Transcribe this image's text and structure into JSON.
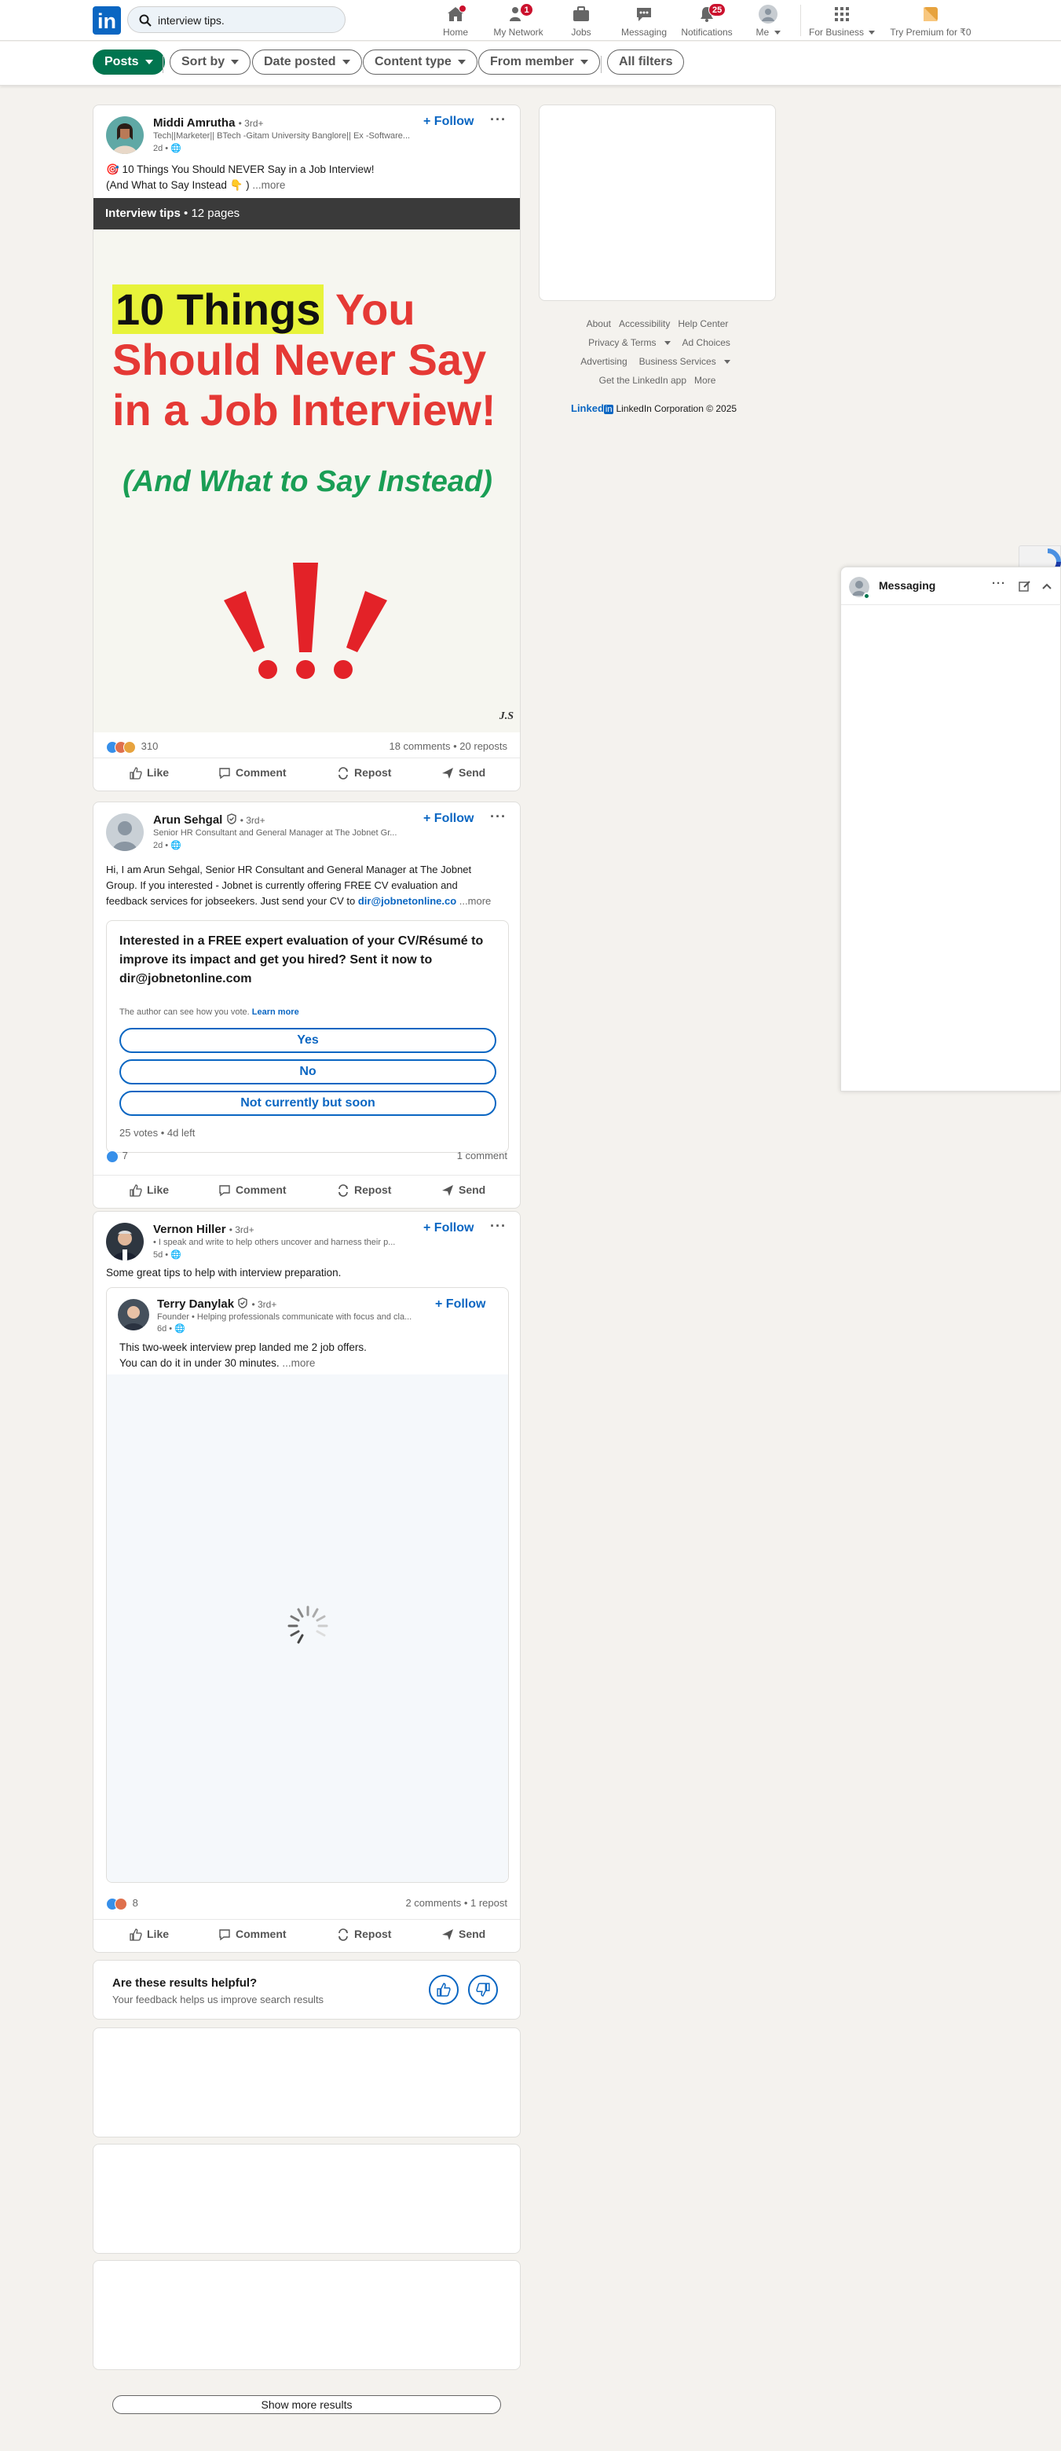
{
  "nav": {
    "search_value": "interview tips.",
    "items": [
      {
        "label": "Home",
        "icon": "home-icon",
        "badge": ""
      },
      {
        "label": "My Network",
        "icon": "network-icon",
        "badge": "1"
      },
      {
        "label": "Jobs",
        "icon": "jobs-icon",
        "badge": ""
      },
      {
        "label": "Messaging",
        "icon": "messaging-icon",
        "badge": ""
      },
      {
        "label": "Notifications",
        "icon": "bell-icon",
        "badge": "25"
      },
      {
        "label": "Me",
        "icon": "avatar",
        "badge": ""
      },
      {
        "label": "For Business",
        "icon": "grid-icon",
        "badge": ""
      },
      {
        "label": "Try Premium for ₹0",
        "icon": "premium-icon",
        "badge": ""
      }
    ]
  },
  "filters": {
    "posts": "Posts",
    "sort_by": "Sort by",
    "date_posted": "Date posted",
    "content_type": "Content type",
    "from_member": "From member",
    "all_filters": "All filters"
  },
  "post1": {
    "author": "Middi Amrutha",
    "degree": "• 3rd+",
    "headline": "Tech||Marketer|| BTech -Gitam University Banglore|| Ex -Software...",
    "time": "2d •",
    "follow": "+ Follow",
    "text_line1": "🎯 10 Things You Should NEVER Say in a Job Interview!",
    "text_line2": "(And What to Say Instead 👇 )",
    "more": "...more",
    "doc_title": "Interview tips",
    "doc_pages": "• 12 pages",
    "slide_highlight": "10 Things",
    "slide_rest1": " You",
    "slide_line2": "Should Never Say",
    "slide_line3": "in a Job Interview!",
    "slide_sub": "(And What to Say Instead)",
    "slide_sig": "J.S",
    "reactions": "310",
    "stats": "18 comments • 20 reposts"
  },
  "post2": {
    "author": "Arun Sehgal",
    "degree": "• 3rd+",
    "headline": "Senior HR Consultant and General Manager at The Jobnet Gr...",
    "time": "2d •",
    "follow": "+ Follow",
    "text1": "Hi, I am Arun Sehgal, Senior HR Consultant and General Manager at The Jobnet",
    "text2": "Group. If you interested - Jobnet is currently offering FREE CV evaluation and",
    "text3": "feedback services for jobseekers. Just send your CV to ",
    "email": "dir@jobnetonline.co",
    "more": "...more",
    "poll_question": "Interested in a FREE expert evaluation of your CV/Résumé to improve its impact and get you hired? Sent it now to dir@jobnetonline.com",
    "poll_note": "The author can see how you vote.",
    "poll_learn": "Learn more",
    "options": [
      "Yes",
      "No",
      "Not currently but soon"
    ],
    "poll_footer": "25 votes • 4d left",
    "reactions": "7",
    "stats": "1 comment"
  },
  "post3": {
    "author": "Vernon Hiller",
    "degree": "• 3rd+",
    "headline": "• I speak and write to help others uncover and harness their p...",
    "time": "5d •",
    "follow": "+ Follow",
    "text": "Some great tips to help with interview preparation.",
    "inner_author": "Terry Danylak",
    "inner_degree": "• 3rd+",
    "inner_headline": "Founder • Helping professionals communicate with focus and cla...",
    "inner_time": "6d •",
    "inner_follow": "+ Follow",
    "inner_text1": "This two-week interview prep landed me 2 job offers.",
    "inner_text2": "You can do it in under 30 minutes.",
    "inner_more": "...more",
    "reactions": "8",
    "stats": "2 comments • 1 repost"
  },
  "actions": {
    "like": "Like",
    "comment": "Comment",
    "repost": "Repost",
    "send": "Send"
  },
  "feedback": {
    "title": "Are these results helpful?",
    "subtitle": "Your feedback helps us improve search results"
  },
  "footer": {
    "links_row1": [
      "About",
      "Accessibility",
      "Help Center"
    ],
    "links_row2": [
      "Privacy & Terms",
      "Ad Choices"
    ],
    "links_row3": [
      "Advertising",
      "Business Services"
    ],
    "links_row4": [
      "Get the LinkedIn app",
      "More"
    ],
    "brand": "Linked",
    "brand_in": "in",
    "copyright": "LinkedIn Corporation © 2025"
  },
  "messaging": {
    "title": "Messaging"
  },
  "show_more": "Show more results",
  "colors": {
    "brand": "#0a66c2",
    "active_filter": "#01754f",
    "badge": "#cb112d"
  }
}
